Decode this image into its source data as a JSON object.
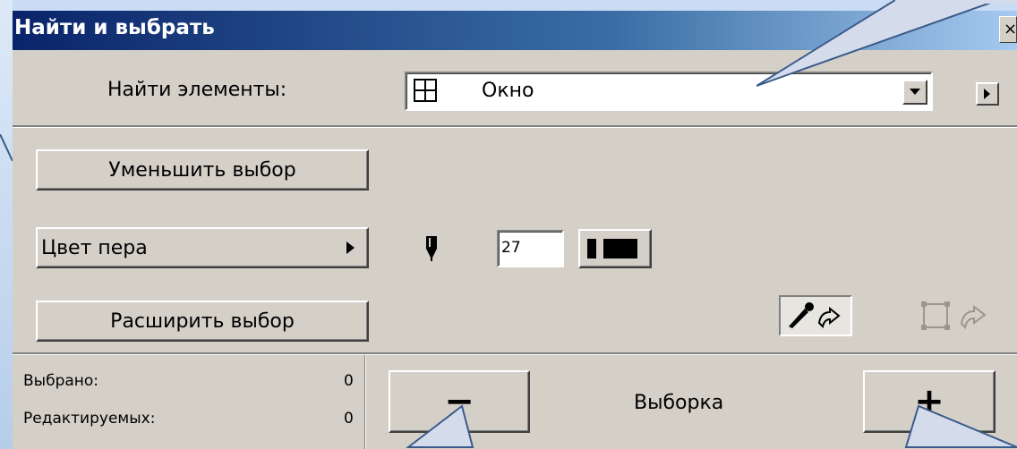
{
  "dialog": {
    "title": "Найти и выбрать",
    "close_label": "×"
  },
  "find": {
    "label": "Найти элементы:",
    "selected": "Окно",
    "icon": "window-grid-icon"
  },
  "buttons": {
    "reduce": "Уменьшить выбор",
    "pen_color": "Цвет пера",
    "expand": "Расширить выбор",
    "minus": "−",
    "plus": "+",
    "selection": "Выборка"
  },
  "pen": {
    "value": "27",
    "icon": "pen-icon"
  },
  "stats": {
    "selected_label": "Выбрано:",
    "selected_value": "0",
    "editable_label": "Редактируемых:",
    "editable_value": "0"
  },
  "colors": {
    "dialog_bg": "#d4d0c8",
    "title_start": "#0a246a",
    "title_end": "#a6caf0",
    "page_bg": "#c9dcf3"
  }
}
